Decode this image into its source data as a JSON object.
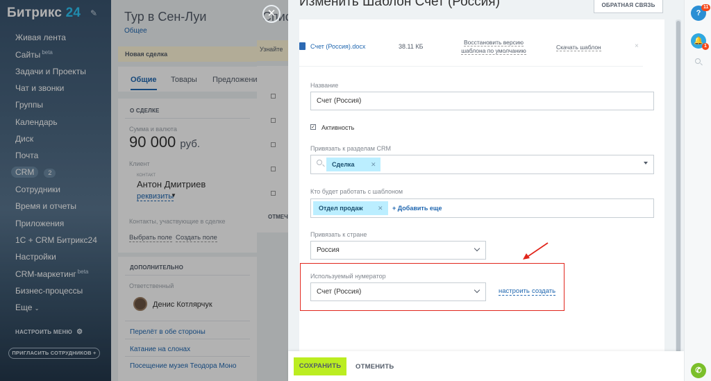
{
  "sidebar": {
    "logo_text": "Битрикс",
    "logo_num": "24",
    "items": [
      {
        "label": "Живая лента"
      },
      {
        "label": "Сайты",
        "sup": "beta"
      },
      {
        "label": "Задачи и Проекты"
      },
      {
        "label": "Чат и звонки"
      },
      {
        "label": "Группы"
      },
      {
        "label": "Календарь"
      },
      {
        "label": "Диск"
      },
      {
        "label": "Почта"
      },
      {
        "label": "CRM",
        "count": "2"
      },
      {
        "label": "Сотрудники"
      },
      {
        "label": "Время и отчеты"
      },
      {
        "label": "Приложения"
      },
      {
        "label": "1С + CRM Битрикс24"
      },
      {
        "label": "Настройки"
      },
      {
        "label": "CRM-маркетинг",
        "sup": "beta"
      },
      {
        "label": "Бизнес-процессы"
      },
      {
        "label": "Еще"
      }
    ],
    "configure_menu": "НАСТРОИТЬ МЕНЮ",
    "invite": "ПРИГЛАСИТЬ СОТРУДНИКОВ"
  },
  "deal": {
    "title": "Тур в Сен-Луи",
    "subtitle": "Общее",
    "stage": "Новая сделка",
    "tabs": [
      "Общие",
      "Товары",
      "Предложения"
    ],
    "about_head": "О СДЕЛКЕ",
    "sum_label": "Сумма и валюта",
    "sum_value": "90 000",
    "sum_currency": "руб.",
    "client_label": "Клиент",
    "contact_caption": "КОНТАКТ",
    "contact_name": "Антон Дмитриев",
    "contact_requisites": "реквизиты",
    "contacts_in_deal": "Контакты, участвующие в сделке",
    "choose_field": "Выбрать поле",
    "create_field": "Создать поле",
    "additional_head": "ДОПОЛНИТЕЛЬНО",
    "responsible_label": "Ответственный",
    "responsible_name": "Денис Котлярчук",
    "links": [
      "Перелёт в обе стороны",
      "Катание на слонах",
      "Посещение музея Теодора Моно"
    ]
  },
  "middle": {
    "title": "Спис",
    "info": "Узнайте",
    "footer": "ОТМЕЧЕНО"
  },
  "panel": {
    "title": "Изменить Шаблон Счет (Россия)",
    "feedback": "ОБРАТНАЯ СВЯЗЬ",
    "file": {
      "name": "Счет (Россия).docx",
      "size": "38.11 КБ",
      "restore_line1": "Восстановить версию",
      "restore_line2": "шаблона по умолчанию",
      "download": "Скачать шаблон",
      "remove": "×"
    },
    "name_label": "Название",
    "name_value": "Счет (Россия)",
    "active_label": "Активность",
    "crm_sections_label": "Привязать к разделам CRM",
    "crm_sections_tag": "Сделка",
    "who_works_label": "Кто будет работать с шаблоном",
    "who_works_tag": "Отдел продаж",
    "add_more": "+ Добавить еще",
    "country_label": "Привязать к стране",
    "country_value": "Россия",
    "numerator_label": "Используемый нумератор",
    "numerator_value": "Счет (Россия)",
    "configure": "настроить",
    "create": "создать",
    "save": "СОХРАНИТЬ",
    "cancel": "ОТМЕНИТЬ"
  },
  "rail": {
    "help": "?",
    "help_badge": "11",
    "notify_badge": "1"
  },
  "colors": {
    "accent_link": "#2067b0",
    "save_green": "#bbed21",
    "tag_blue": "#bbeeff",
    "highlight_red": "#e1251b"
  }
}
